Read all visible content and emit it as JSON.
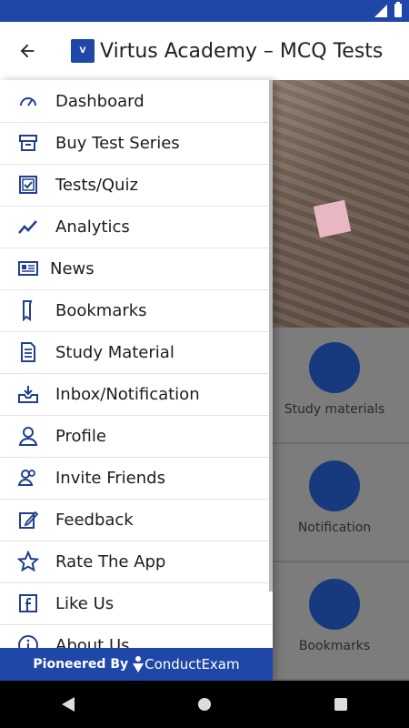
{
  "app": {
    "title": "Virtus Academy – MCQ Tests",
    "logo_text": "V"
  },
  "drawer": {
    "items": [
      {
        "label": "Dashboard",
        "icon": "dashboard-gauge-icon"
      },
      {
        "label": "Buy Test Series",
        "icon": "buy-box-icon"
      },
      {
        "label": "Tests/Quiz",
        "icon": "quiz-checkbox-icon"
      },
      {
        "label": "Analytics",
        "icon": "analytics-chart-icon"
      },
      {
        "label": "News",
        "icon": "news-icon"
      },
      {
        "label": "Bookmarks",
        "icon": "bookmark-icon"
      },
      {
        "label": "Study Material",
        "icon": "document-icon"
      },
      {
        "label": "Inbox/Notification",
        "icon": "inbox-icon"
      },
      {
        "label": "Profile",
        "icon": "user-icon"
      },
      {
        "label": "Invite Friends",
        "icon": "invite-users-icon"
      },
      {
        "label": "Feedback",
        "icon": "feedback-edit-icon"
      },
      {
        "label": "Rate The App",
        "icon": "star-icon"
      },
      {
        "label": "Like Us",
        "icon": "facebook-icon"
      },
      {
        "label": "About Us",
        "icon": "info-icon"
      }
    ],
    "footer": {
      "prefix": "Pioneered By",
      "brand": "ConductExam"
    }
  },
  "background": {
    "tiles": [
      {
        "label": "Study materials"
      },
      {
        "label": "Notification"
      },
      {
        "label": "Bookmarks"
      }
    ]
  },
  "colors": {
    "primary": "#1f47a8",
    "icon": "#1f3f8f",
    "text": "#1c1c1c"
  }
}
